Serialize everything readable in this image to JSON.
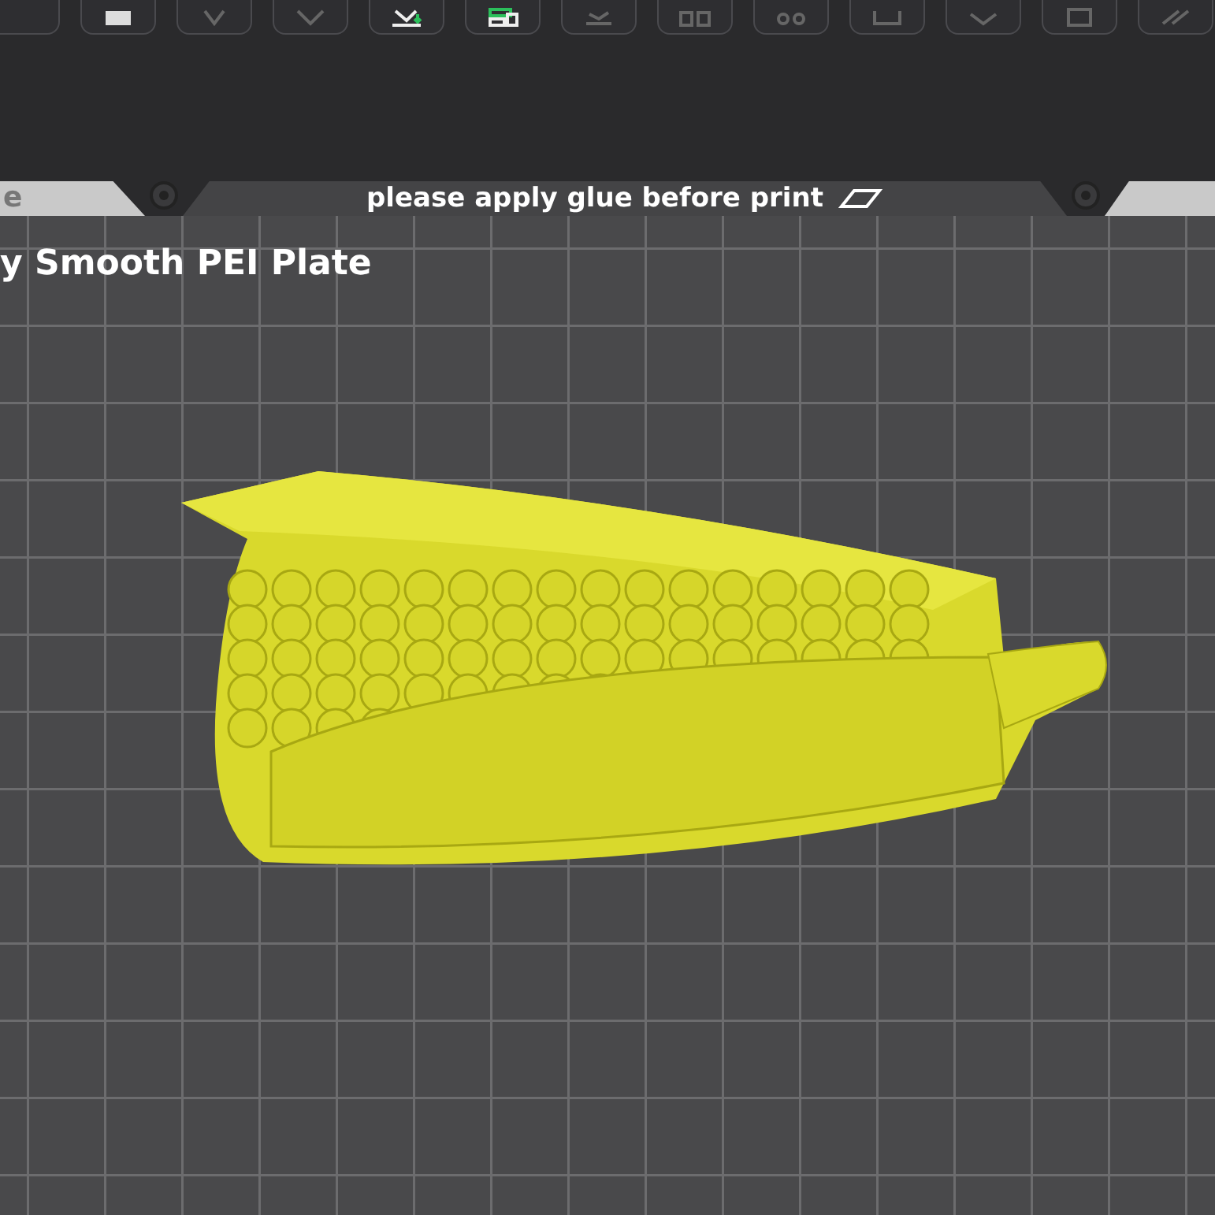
{
  "plate_header": {
    "left_tab": "e",
    "notice": "please apply glue before print"
  },
  "plate": {
    "name": "y Smooth PEI Plate"
  }
}
